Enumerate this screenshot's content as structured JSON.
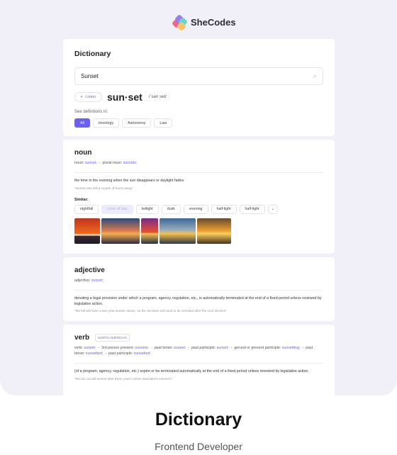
{
  "brand": {
    "name": "SheCodes"
  },
  "dictionary": {
    "title": "Dictionary",
    "search_value": "Sunset",
    "listen_label": "Listen",
    "word": "sun·set",
    "phonetic": "/ˈsənˌset/",
    "see_label": "See definitions in:",
    "filters": [
      "All",
      "Horology",
      "Astronomy",
      "Law"
    ]
  },
  "noun": {
    "pos": "noun",
    "forms": [
      {
        "label": "noun:",
        "value": "sunset;"
      },
      {
        "label": "plural noun:",
        "value": "sunsets;"
      }
    ],
    "definition": "the time in the evening when the sun disappears or daylight fades.",
    "example": "\"sunset was still a couple of hours away\"",
    "similar_label": "Similar:",
    "similar": [
      "nightfall",
      "close of day",
      "twilight",
      "dusk",
      "evening",
      "half-light",
      "half-light"
    ]
  },
  "adjective": {
    "pos": "adjective",
    "forms": [
      {
        "label": "adjective:",
        "value": "sunset;"
      }
    ],
    "definition": "denoting a legal provision under which a program, agency, regulation, etc., is automatically terminated at the end of a fixed period unless renewed by legislative action.",
    "example": "\"the bill will have a two-year sunset clause, so the decision will need to be revisited after the next election\""
  },
  "verb": {
    "pos": "verb",
    "badge": "NORTH AMERICAN",
    "forms": [
      {
        "label": "verb:",
        "value": "sunset;"
      },
      {
        "label": "3rd person present:",
        "value": "sunsets;"
      },
      {
        "label": "past tense:",
        "value": "sunset;"
      },
      {
        "label": "past participle:",
        "value": "sunset;"
      },
      {
        "label": "gerund or present participle:",
        "value": "sunsetting;"
      },
      {
        "label": "past tense:",
        "value": "sunsetted;"
      },
      {
        "label": "past participle:",
        "value": "sunsetted"
      }
    ],
    "definition": "(of a program, agency, regulation, etc.) expire or be terminated automatically at the end of a fixed period unless renewed by legislative action.",
    "example": "\"the tax cut will sunset after three years unless lawmakers extend it\""
  },
  "footer": {
    "title": "Dictionary",
    "subtitle": "Frontend Developer"
  },
  "colors": {
    "accent": "#6b5ff5",
    "background": "#f1f0f8"
  }
}
